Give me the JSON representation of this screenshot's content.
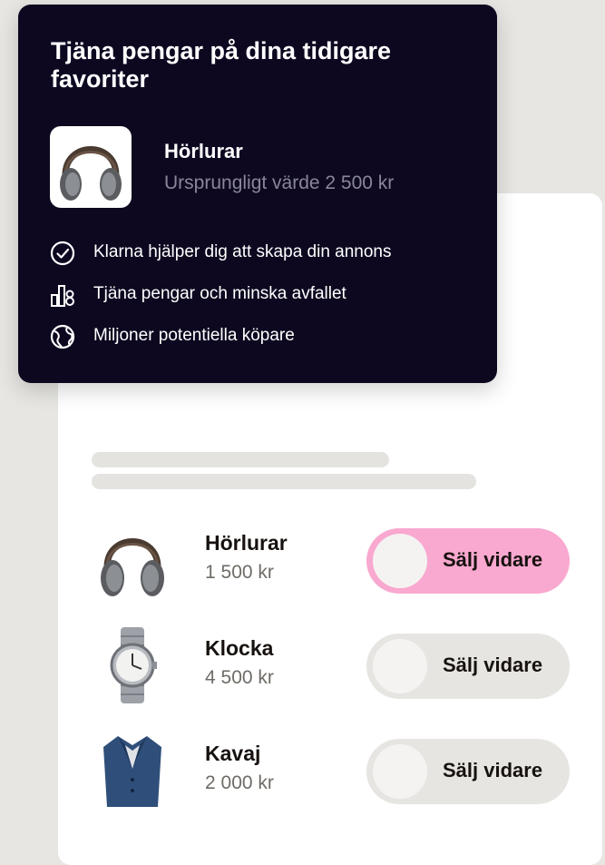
{
  "promo": {
    "title": "Tjäna pengar på dina tidigare favoriter",
    "product": {
      "name": "Hörlurar",
      "value_text": "Ursprungligt värde 2 500 kr",
      "icon": "headphones-image"
    },
    "features": [
      {
        "icon": "check-circle-icon",
        "text": "Klarna hjälper dig att skapa din annons"
      },
      {
        "icon": "bar-chart-icon",
        "text": "Tjäna pengar och minska avfallet"
      },
      {
        "icon": "globe-icon",
        "text": "Miljoner potentiella köpare"
      }
    ]
  },
  "list": {
    "items": [
      {
        "name": "Hörlurar",
        "price": "1 500 kr",
        "toggle_label": "Sälj vidare",
        "toggle_on": true,
        "image": "headphones-image"
      },
      {
        "name": "Klocka",
        "price": "4 500 kr",
        "toggle_label": "Sälj vidare",
        "toggle_on": false,
        "image": "watch-image"
      },
      {
        "name": "Kavaj",
        "price": "2 000 kr",
        "toggle_label": "Sälj vidare",
        "toggle_on": false,
        "image": "blazer-image"
      }
    ]
  },
  "colors": {
    "background": "#e7e6e2",
    "dark_card": "#0d0820",
    "toggle_on": "#f9a8cf",
    "toggle_off": "#e6e5e1",
    "muted_text": "#8a8699"
  }
}
